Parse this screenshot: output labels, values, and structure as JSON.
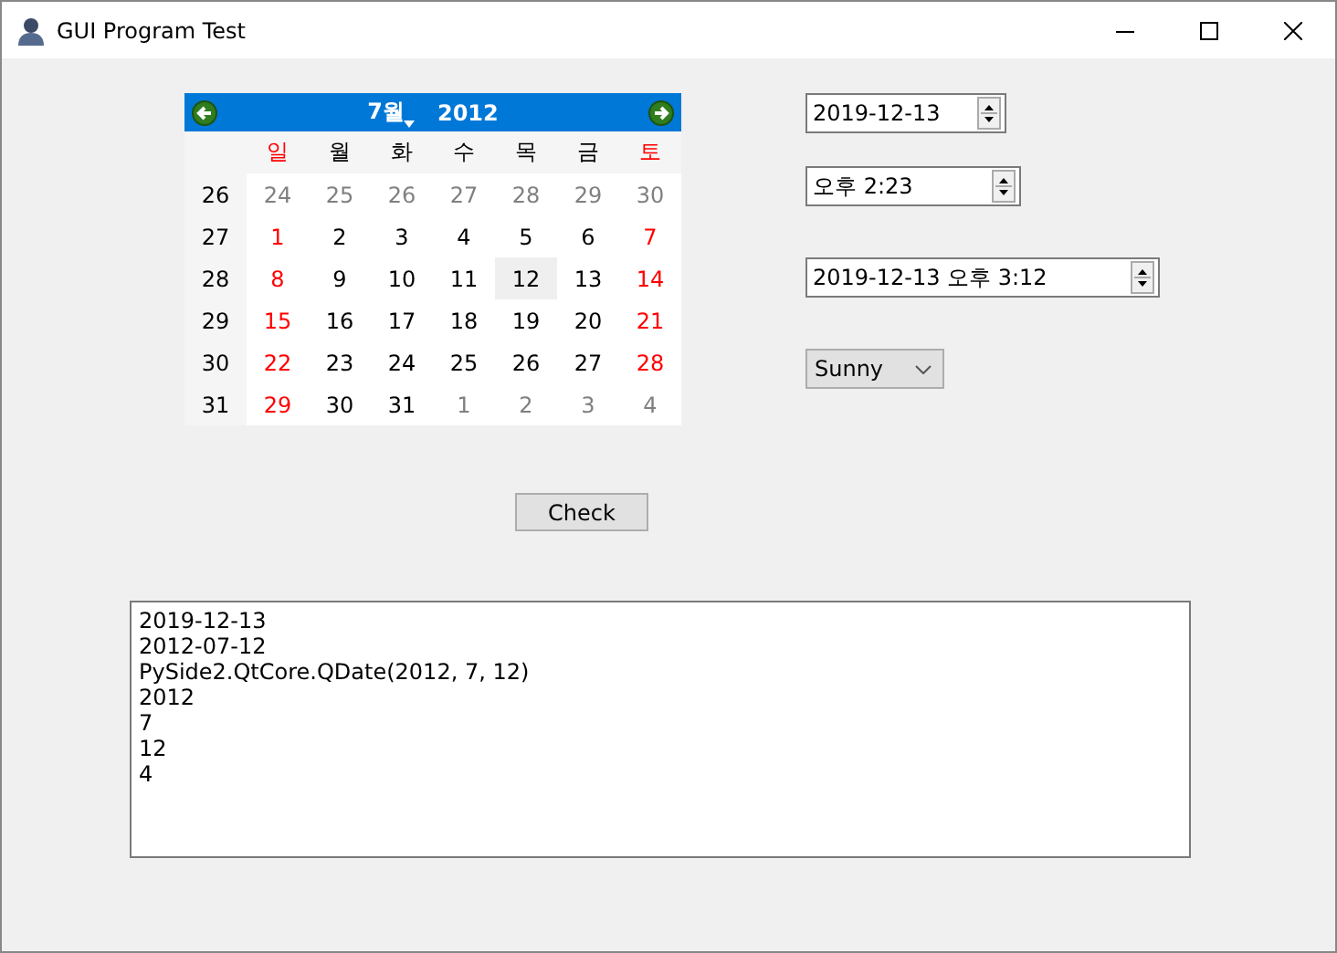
{
  "window": {
    "title": "GUI Program Test"
  },
  "calendar": {
    "month": "7월",
    "year": "2012",
    "weekdays": [
      {
        "label": "일",
        "weekend": true
      },
      {
        "label": "월",
        "weekend": false
      },
      {
        "label": "화",
        "weekend": false
      },
      {
        "label": "수",
        "weekend": false
      },
      {
        "label": "목",
        "weekend": false
      },
      {
        "label": "금",
        "weekend": false
      },
      {
        "label": "토",
        "weekend": true
      }
    ],
    "weeks": [
      {
        "number": "26",
        "days": [
          {
            "day": "24",
            "kind": "other",
            "selected": false
          },
          {
            "day": "25",
            "kind": "other",
            "selected": false
          },
          {
            "day": "26",
            "kind": "other",
            "selected": false
          },
          {
            "day": "27",
            "kind": "other",
            "selected": false
          },
          {
            "day": "28",
            "kind": "other",
            "selected": false
          },
          {
            "day": "29",
            "kind": "other",
            "selected": false
          },
          {
            "day": "30",
            "kind": "other",
            "selected": false
          }
        ]
      },
      {
        "number": "27",
        "days": [
          {
            "day": "1",
            "kind": "weekend",
            "selected": false
          },
          {
            "day": "2",
            "kind": "normal",
            "selected": false
          },
          {
            "day": "3",
            "kind": "normal",
            "selected": false
          },
          {
            "day": "4",
            "kind": "normal",
            "selected": false
          },
          {
            "day": "5",
            "kind": "normal",
            "selected": false
          },
          {
            "day": "6",
            "kind": "normal",
            "selected": false
          },
          {
            "day": "7",
            "kind": "weekend",
            "selected": false
          }
        ]
      },
      {
        "number": "28",
        "days": [
          {
            "day": "8",
            "kind": "weekend",
            "selected": false
          },
          {
            "day": "9",
            "kind": "normal",
            "selected": false
          },
          {
            "day": "10",
            "kind": "normal",
            "selected": false
          },
          {
            "day": "11",
            "kind": "normal",
            "selected": false
          },
          {
            "day": "12",
            "kind": "normal",
            "selected": true
          },
          {
            "day": "13",
            "kind": "normal",
            "selected": false
          },
          {
            "day": "14",
            "kind": "weekend",
            "selected": false
          }
        ]
      },
      {
        "number": "29",
        "days": [
          {
            "day": "15",
            "kind": "weekend",
            "selected": false
          },
          {
            "day": "16",
            "kind": "normal",
            "selected": false
          },
          {
            "day": "17",
            "kind": "normal",
            "selected": false
          },
          {
            "day": "18",
            "kind": "normal",
            "selected": false
          },
          {
            "day": "19",
            "kind": "normal",
            "selected": false
          },
          {
            "day": "20",
            "kind": "normal",
            "selected": false
          },
          {
            "day": "21",
            "kind": "weekend",
            "selected": false
          }
        ]
      },
      {
        "number": "30",
        "days": [
          {
            "day": "22",
            "kind": "weekend",
            "selected": false
          },
          {
            "day": "23",
            "kind": "normal",
            "selected": false
          },
          {
            "day": "24",
            "kind": "normal",
            "selected": false
          },
          {
            "day": "25",
            "kind": "normal",
            "selected": false
          },
          {
            "day": "26",
            "kind": "normal",
            "selected": false
          },
          {
            "day": "27",
            "kind": "normal",
            "selected": false
          },
          {
            "day": "28",
            "kind": "weekend",
            "selected": false
          }
        ]
      },
      {
        "number": "31",
        "days": [
          {
            "day": "29",
            "kind": "weekend",
            "selected": false
          },
          {
            "day": "30",
            "kind": "normal",
            "selected": false
          },
          {
            "day": "31",
            "kind": "normal",
            "selected": false
          },
          {
            "day": "1",
            "kind": "other",
            "selected": false
          },
          {
            "day": "2",
            "kind": "other",
            "selected": false
          },
          {
            "day": "3",
            "kind": "other",
            "selected": false
          },
          {
            "day": "4",
            "kind": "other",
            "selected": false
          }
        ]
      }
    ]
  },
  "date_edit": {
    "value": "2019-12-13"
  },
  "time_edit": {
    "value": "오후 2:23"
  },
  "datetime_edit": {
    "value": "2019-12-13 오후 3:12"
  },
  "combo": {
    "value": "Sunny"
  },
  "check_button": {
    "label": "Check"
  },
  "output": {
    "lines": [
      "2019-12-13",
      "2012-07-12",
      "PySide2.QtCore.QDate(2012, 7, 12)",
      "2012",
      "7",
      "12",
      "4"
    ]
  }
}
